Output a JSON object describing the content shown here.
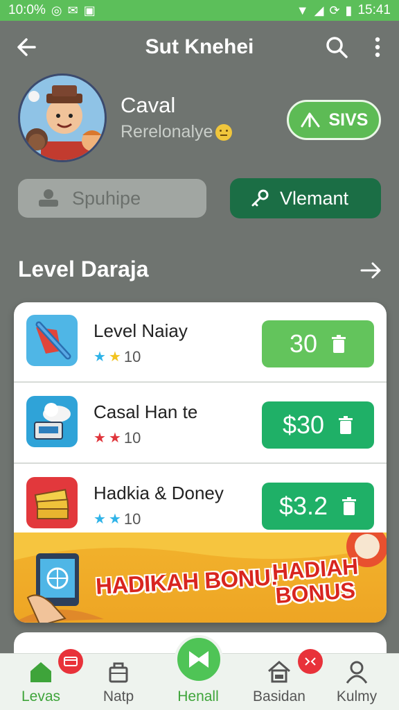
{
  "status_bar": {
    "time_left": "10:0%",
    "time_right": "15:41"
  },
  "app_bar": {
    "title": "Sut Knehei"
  },
  "profile": {
    "name": "Caval",
    "subtitle": "Rerelonalye",
    "action_button_label": "SIVS"
  },
  "actions": {
    "left_label": "Spuhipe",
    "right_label": "Vlemant"
  },
  "section": {
    "title": "Level Daraja"
  },
  "items": [
    {
      "name": "Level Naiay",
      "rating": "10",
      "price": "30",
      "star_colors": [
        "#2fb3e8",
        "#f2c320"
      ],
      "price_style": "light"
    },
    {
      "name": "Casal Han te",
      "rating": "10",
      "price": "$30",
      "star_colors": [
        "#e0353b",
        "#e0353b"
      ],
      "price_style": "dark"
    },
    {
      "name": "Hadkia & Doney",
      "rating": "10",
      "price": "$3.2",
      "star_colors": [
        "#2fb3e8",
        "#2fb3e8"
      ],
      "price_style": "dark"
    }
  ],
  "banner": {
    "text_left": "HADIKAH BONU!",
    "text_right_line1": "HADIAH",
    "text_right_line2": "BONUS"
  },
  "bottom_nav": [
    {
      "label": "Levas",
      "active": true
    },
    {
      "label": "Natp",
      "active": false
    },
    {
      "label": "Henall",
      "active": true
    },
    {
      "label": "Basidan",
      "active": false
    },
    {
      "label": "Kulmy",
      "active": false
    }
  ],
  "colors": {
    "accent_green": "#5cbf5a",
    "dark_green": "#1b6e45",
    "price_green": "#1fb067",
    "badge_red": "#e8323a",
    "background": "#6f7470"
  }
}
